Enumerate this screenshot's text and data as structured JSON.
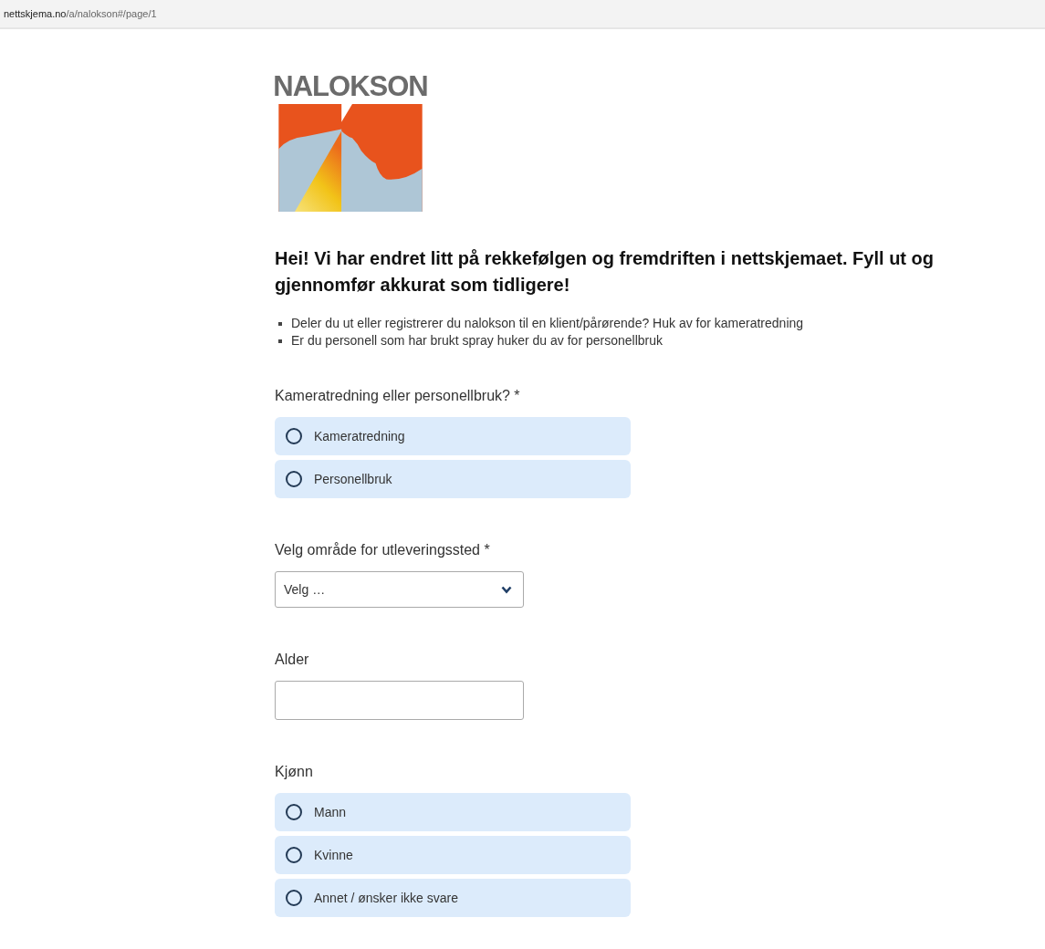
{
  "address_bar": {
    "host": "nettskjema.no",
    "path": "/a/nalokson#/page/1"
  },
  "logo": {
    "text": "NALOKSON"
  },
  "heading": "Hei! Vi har endret litt på rekkefølgen og fremdriften i nettskjemaet. Fyll ut og gjennomfør akkurat som tidligere!",
  "bullets": [
    "Deler du ut eller registrerer du nalokson til en klient/pårørende? Huk av for kameratredning",
    "Er du personell som har brukt spray huker du av for personellbruk"
  ],
  "questions": [
    {
      "kind": "radio",
      "label": "Kameratredning eller personellbruk? *",
      "options": [
        {
          "label": "Kameratredning",
          "selected": false
        },
        {
          "label": "Personellbruk",
          "selected": false
        }
      ]
    },
    {
      "kind": "select",
      "label": "Velg område for utleveringssted *",
      "value": "Velg …"
    },
    {
      "kind": "text",
      "label": "Alder"
    },
    {
      "kind": "radio",
      "label": "Kjønn",
      "options": [
        {
          "label": "Mann",
          "selected": false
        },
        {
          "label": "Kvinne",
          "selected": false
        },
        {
          "label": "Annet / ønsker ikke svare",
          "selected": false
        }
      ]
    }
  ]
}
